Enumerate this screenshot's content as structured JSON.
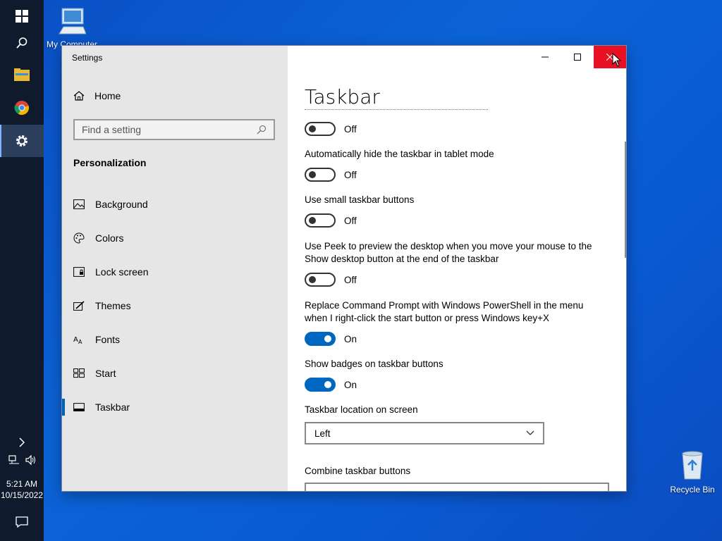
{
  "desktop": {
    "icons": [
      {
        "label": "My Computer",
        "name": "my-computer"
      },
      {
        "label": "Recycle Bin",
        "name": "recycle-bin"
      }
    ]
  },
  "taskbar": {
    "time": "5:21 AM",
    "date": "10/15/2022"
  },
  "window": {
    "title": "Settings",
    "nav": {
      "home": "Home",
      "search_placeholder": "Find a setting",
      "section": "Personalization",
      "items": [
        {
          "label": "Background",
          "icon": "background-icon"
        },
        {
          "label": "Colors",
          "icon": "palette-icon"
        },
        {
          "label": "Lock screen",
          "icon": "lock-screen-icon"
        },
        {
          "label": "Themes",
          "icon": "themes-icon"
        },
        {
          "label": "Fonts",
          "icon": "fonts-icon"
        },
        {
          "label": "Start",
          "icon": "start-icon"
        },
        {
          "label": "Taskbar",
          "icon": "taskbar-icon",
          "selected": true
        }
      ]
    },
    "content": {
      "title": "Taskbar",
      "settings": [
        {
          "label": "",
          "state": "Off",
          "on": false
        },
        {
          "label": "Automatically hide the taskbar in tablet mode",
          "state": "Off",
          "on": false
        },
        {
          "label": "Use small taskbar buttons",
          "state": "Off",
          "on": false
        },
        {
          "label": "Use Peek to preview the desktop when you move your mouse to the Show desktop button at the end of the taskbar",
          "state": "Off",
          "on": false
        },
        {
          "label": "Replace Command Prompt with Windows PowerShell in the menu when I right-click the start button or press Windows key+X",
          "state": "On",
          "on": true
        },
        {
          "label": "Show badges on taskbar buttons",
          "state": "On",
          "on": true
        }
      ],
      "location_label": "Taskbar location on screen",
      "location_value": "Left",
      "combine_label": "Combine taskbar buttons"
    }
  },
  "colors": {
    "accent": "#0067c0",
    "close": "#e81123",
    "nav_bg": "#e6e6e6",
    "taskbar_bg": "#0f1b2d"
  }
}
